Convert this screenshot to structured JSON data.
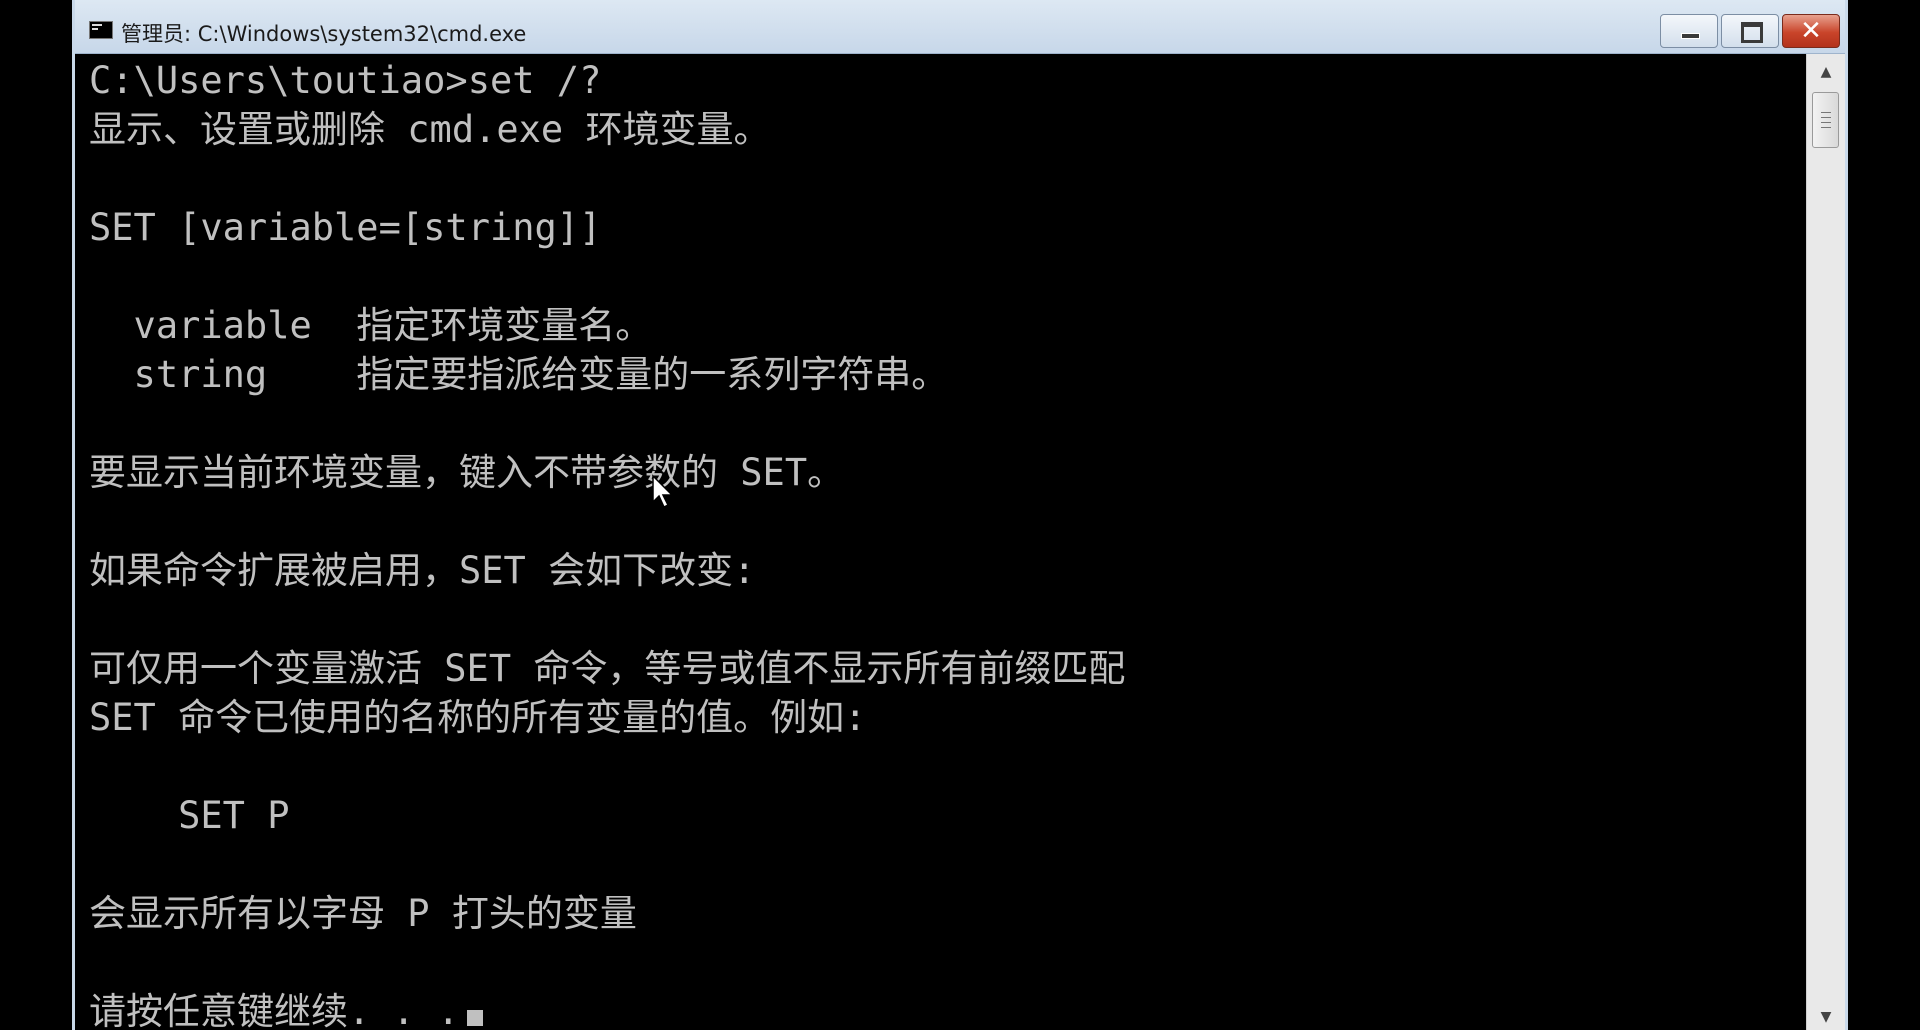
{
  "window": {
    "title": "管理员: C:\\Windows\\system32\\cmd.exe",
    "controls": {
      "minimize_icon": "minimize-icon",
      "maximize_icon": "maximize-icon",
      "close_icon": "close-icon",
      "close_glyph": "✕",
      "close_color": "#c9442a"
    }
  },
  "console": {
    "background": "#000000",
    "foreground": "#c0c0c0",
    "lines": [
      "C:\\Users\\toutiao>set /?",
      "显示、设置或删除 cmd.exe 环境变量。",
      "",
      "SET [variable=[string]]",
      "",
      "  variable  指定环境变量名。",
      "  string    指定要指派给变量的一系列字符串。",
      "",
      "要显示当前环境变量，键入不带参数的 SET。",
      "",
      "如果命令扩展被启用，SET 会如下改变:",
      "",
      "可仅用一个变量激活 SET 命令，等号或值不显示所有前缀匹配",
      "SET 命令已使用的名称的所有变量的值。例如:",
      "",
      "    SET P",
      "",
      "会显示所有以字母 P 打头的变量",
      "",
      "请按任意键继续. . ."
    ]
  },
  "scrollbar": {
    "up_arrow": "▲",
    "down_arrow": "▼"
  }
}
